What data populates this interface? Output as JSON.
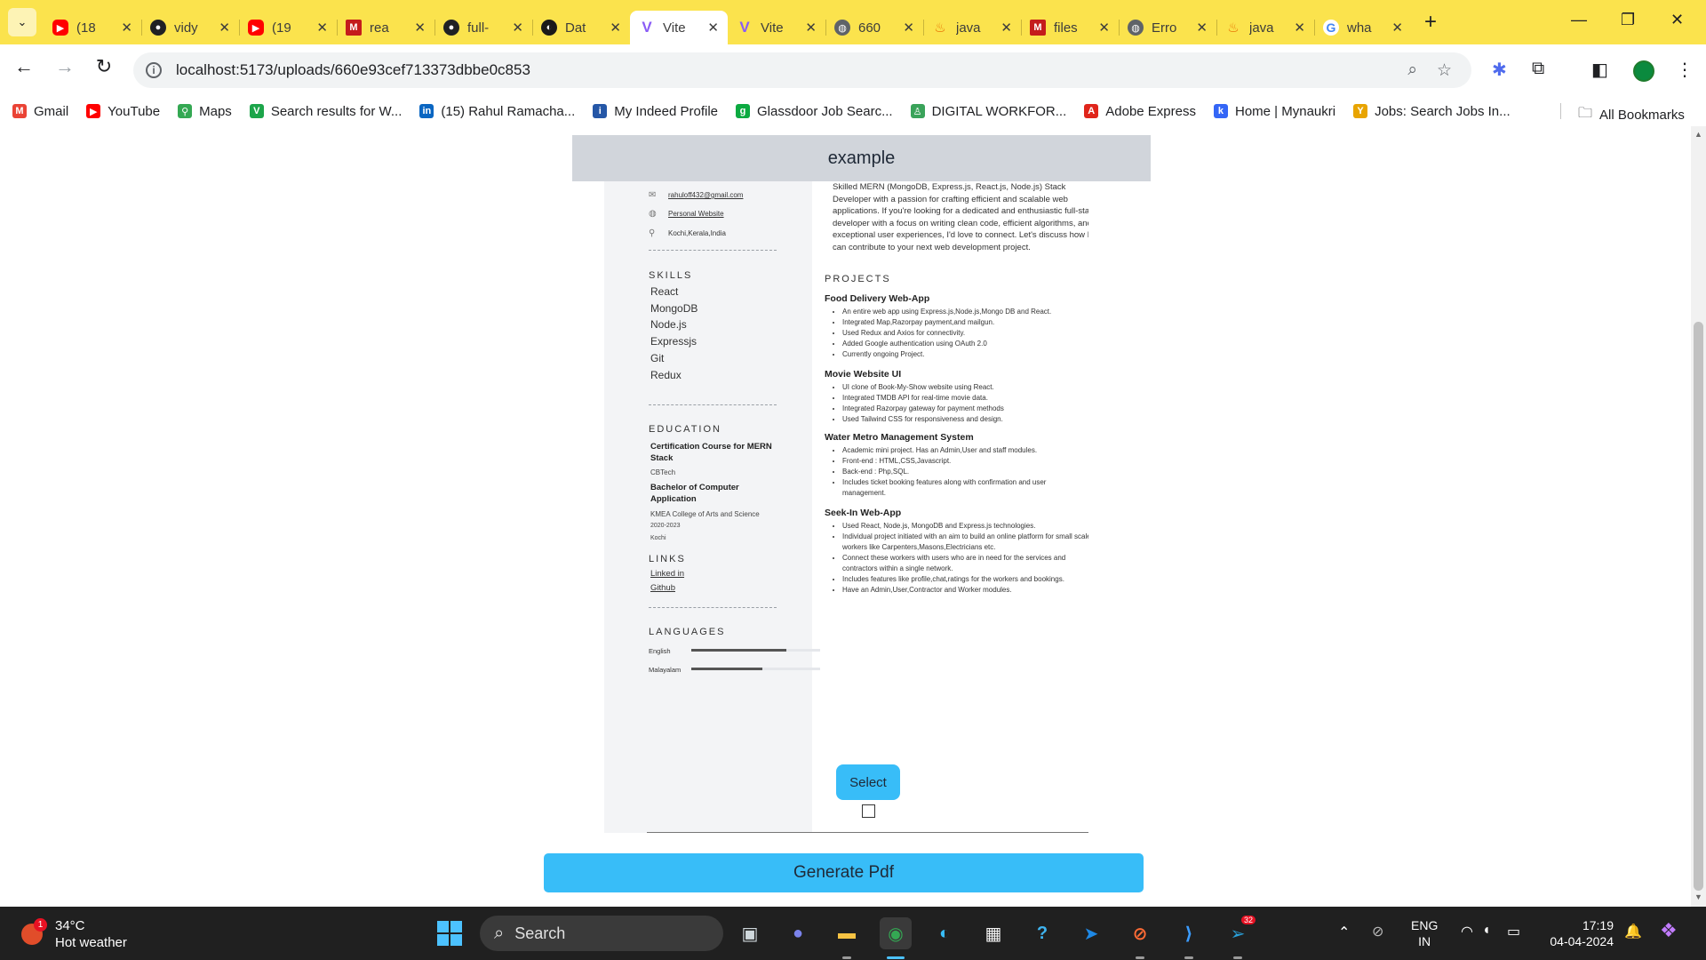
{
  "browser": {
    "tabs": [
      {
        "title": "(18",
        "icon": "youtube-icon"
      },
      {
        "title": "vidy",
        "icon": "github-icon"
      },
      {
        "title": "(19",
        "icon": "youtube-icon"
      },
      {
        "title": "rea",
        "icon": "medium-icon"
      },
      {
        "title": "full-",
        "icon": "github-icon"
      },
      {
        "title": "Dat",
        "icon": "dat-icon"
      },
      {
        "title": "Vite",
        "icon": "vite-icon",
        "active": true
      },
      {
        "title": "Vite",
        "icon": "vite-icon"
      },
      {
        "title": "660",
        "icon": "globe-icon"
      },
      {
        "title": "java",
        "icon": "java-icon"
      },
      {
        "title": "files",
        "icon": "medium-icon"
      },
      {
        "title": "Erro",
        "icon": "globe-icon"
      },
      {
        "title": "java",
        "icon": "java-icon"
      },
      {
        "title": "wha",
        "icon": "google-icon"
      }
    ],
    "url": "localhost:5173/uploads/660e93cef713373dbbe0c853",
    "bookmarks": [
      {
        "label": "Gmail",
        "icon": "gmail-icon"
      },
      {
        "label": "YouTube",
        "icon": "youtube-icon"
      },
      {
        "label": "Maps",
        "icon": "maps-icon"
      },
      {
        "label": "Search results for W...",
        "icon": "vuetify-icon"
      },
      {
        "label": "(15) Rahul Ramacha...",
        "icon": "linkedin-icon"
      },
      {
        "label": "My Indeed Profile",
        "icon": "indeed-icon"
      },
      {
        "label": "Glassdoor Job Searc...",
        "icon": "glassdoor-icon"
      },
      {
        "label": "DIGITAL WORKFOR...",
        "icon": "workforce-icon"
      },
      {
        "label": "Adobe Express",
        "icon": "adobe-icon"
      },
      {
        "label": "Home | Mynaukri",
        "icon": "mynaukri-icon"
      },
      {
        "label": "Jobs: Search Jobs In...",
        "icon": "jobs-icon"
      }
    ],
    "all_bookmarks_label": "All Bookmarks"
  },
  "page": {
    "header_title": "example",
    "resume": {
      "contact": {
        "email": "rahuloff432@gmail.com",
        "website": "Personal Website",
        "location": "Kochi,Kerala,India"
      },
      "skills_heading": "SKILLS",
      "skills": [
        "React",
        "MongoDB",
        "Node.js",
        "Expressjs",
        "Git",
        "Redux"
      ],
      "education_heading": "EDUCATION",
      "education": [
        {
          "title": "Certification Course for MERN Stack",
          "school": "CBTech"
        },
        {
          "title": "Bachelor of Computer Application",
          "school": "KMEA College of Arts and Science",
          "years": "2020-2023",
          "place": "Kochi"
        }
      ],
      "links_heading": "LINKS",
      "links": [
        "Linked in",
        "Github"
      ],
      "languages_heading": "LANGUAGES",
      "languages": [
        {
          "name": "English",
          "level": 0.74
        },
        {
          "name": "Malayalam",
          "level": 0.55
        }
      ],
      "summary": "Skilled MERN (MongoDB, Express.js, React.js, Node.js) Stack Developer with a passion for crafting efficient and scalable web applications. If you're looking for a dedicated and enthusiastic full-stack developer with a focus on writing clean code, efficient algorithms, and exceptional user experiences, I'd love to connect. Let's discuss how I can contribute to your next web development project.",
      "projects_heading": "PROJECTS",
      "projects": [
        {
          "title": "Food Delivery Web-App",
          "points": [
            "An entire web app using Express.js,Node.js,Mongo DB and React.",
            "Integrated Map,Razorpay payment,and mailgun.",
            "Used Redux and Axios for connectivity.",
            "Added Google authentication using OAuth 2.0",
            "Currently ongoing Project."
          ]
        },
        {
          "title": "Movie Website UI",
          "points": [
            "UI clone of Book-My-Show website using React.",
            "Integrated TMDB API for real-time movie data.",
            "Integrated Razorpay gateway for payment methods",
            "Used Tailwind CSS for responsiveness and design."
          ]
        },
        {
          "title": "Water Metro Management System",
          "points": [
            "Academic mini project. Has an Admin,User and staff modules.",
            "Front-end : HTML,CSS,Javascript.",
            "Back-end : Php,SQL.",
            "Includes ticket booking features along with confirmation and user management."
          ]
        },
        {
          "title": "Seek-In Web-App",
          "points": [
            "Used React, Node.js, MongoDB and Express.js technologies.",
            "Individual project initiated with an aim to build an online platform for small scale workers like Carpenters,Masons,Electricians etc.",
            "Connect these workers with users who are in need for the services and contractors within a single network.",
            "Includes features like profile,chat,ratings for the workers and bookings.",
            "Have an Admin,User,Contractor and Worker modules."
          ]
        }
      ]
    },
    "select_label": "Select",
    "generate_label": "Generate Pdf"
  },
  "taskbar": {
    "weather_temp": "34°C",
    "weather_desc": "Hot weather",
    "weather_badge": "1",
    "search_label": "Search",
    "telegram_badge": "32",
    "lang_line1": "ENG",
    "lang_line2": "IN",
    "time": "17:19",
    "date": "04-04-2024"
  }
}
